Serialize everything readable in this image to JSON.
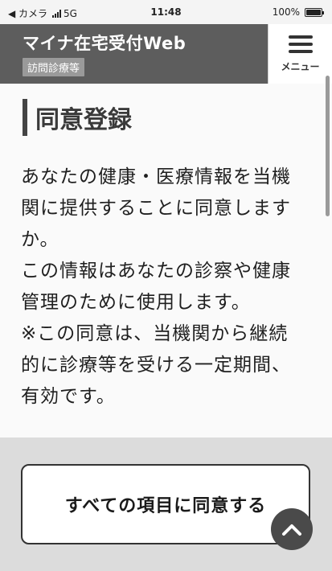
{
  "status_bar": {
    "back_app": "◀ カメラ",
    "network": "5G",
    "time": "11:48",
    "battery": "100%",
    "battery_level": 1.0
  },
  "header": {
    "title": "マイナ在宅受付Web",
    "badge": "訪問診療等",
    "menu_label": "メニュー"
  },
  "main": {
    "heading": "同意登録",
    "paragraphs": [
      "あなたの健康・医療情報を当機関に提供することに同意しますか。",
      "この情報はあなたの診察や健康管理のために使用します。",
      "※この同意は、当機関から継続的に診療等を受ける一定期間、有効です。"
    ]
  },
  "actions": {
    "consent_all_label": "すべての項目に同意する"
  },
  "icons": {
    "scroll_top": "chevron-up-icon",
    "menu": "hamburger-icon"
  },
  "colors": {
    "header_bg": "#5d5d5d",
    "badge_bg": "#9a9a9a",
    "scroll_top_bg": "#4a4a4a"
  }
}
